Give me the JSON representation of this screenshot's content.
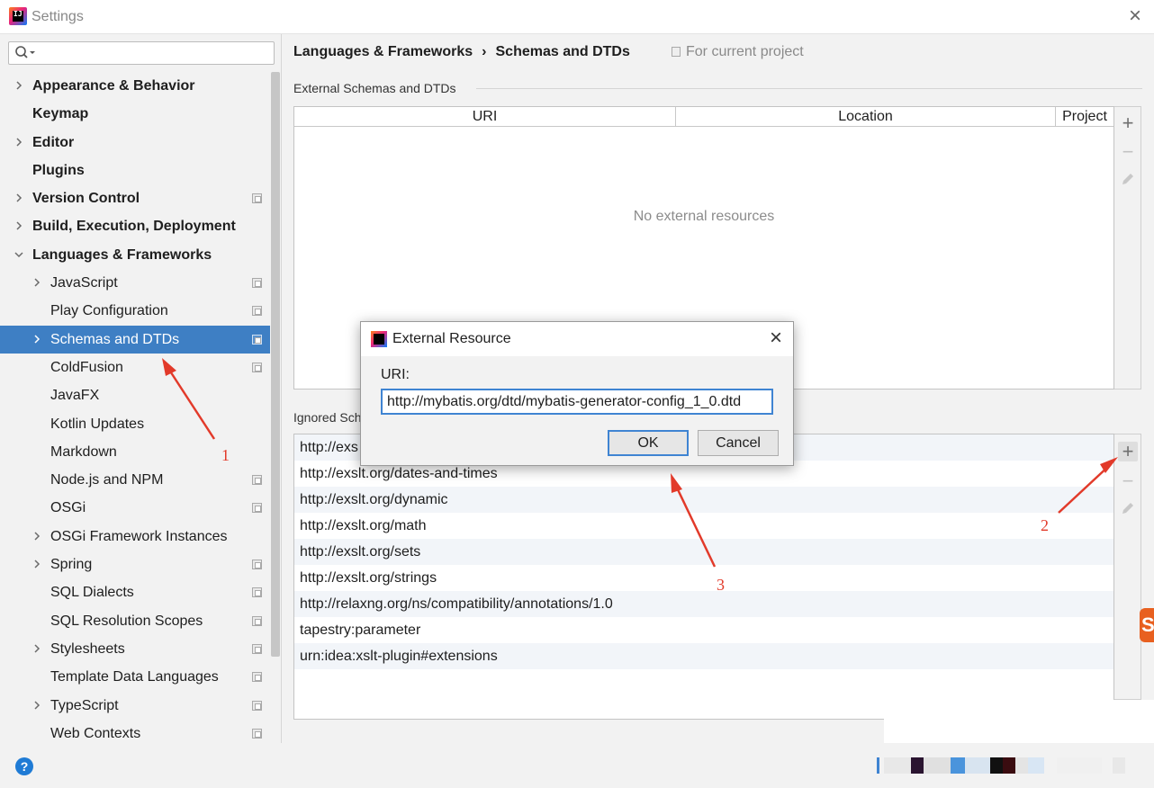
{
  "window": {
    "title": "Settings",
    "close_glyph": "×"
  },
  "search": {
    "placeholder": "",
    "value": ""
  },
  "sidebar": {
    "items": [
      {
        "label": "Appearance & Behavior",
        "level": 0,
        "chevron": "right",
        "project": false,
        "selected": false
      },
      {
        "label": "Keymap",
        "level": 0,
        "chevron": "none",
        "project": false,
        "selected": false
      },
      {
        "label": "Editor",
        "level": 0,
        "chevron": "right",
        "project": false,
        "selected": false
      },
      {
        "label": "Plugins",
        "level": 0,
        "chevron": "none",
        "project": false,
        "selected": false
      },
      {
        "label": "Version Control",
        "level": 0,
        "chevron": "right",
        "project": true,
        "selected": false
      },
      {
        "label": "Build, Execution, Deployment",
        "level": 0,
        "chevron": "right",
        "project": false,
        "selected": false
      },
      {
        "label": "Languages & Frameworks",
        "level": 0,
        "chevron": "down",
        "project": false,
        "selected": false
      },
      {
        "label": "JavaScript",
        "level": 1,
        "chevron": "right",
        "project": true,
        "selected": false
      },
      {
        "label": "Play Configuration",
        "level": 1,
        "chevron": "none",
        "project": true,
        "selected": false
      },
      {
        "label": "Schemas and DTDs",
        "level": 1,
        "chevron": "right",
        "project": true,
        "selected": true
      },
      {
        "label": "ColdFusion",
        "level": 1,
        "chevron": "none",
        "project": true,
        "selected": false
      },
      {
        "label": "JavaFX",
        "level": 1,
        "chevron": "none",
        "project": false,
        "selected": false
      },
      {
        "label": "Kotlin Updates",
        "level": 1,
        "chevron": "none",
        "project": false,
        "selected": false
      },
      {
        "label": "Markdown",
        "level": 1,
        "chevron": "none",
        "project": false,
        "selected": false
      },
      {
        "label": "Node.js and NPM",
        "level": 1,
        "chevron": "none",
        "project": true,
        "selected": false
      },
      {
        "label": "OSGi",
        "level": 1,
        "chevron": "none",
        "project": true,
        "selected": false
      },
      {
        "label": "OSGi Framework Instances",
        "level": 1,
        "chevron": "right",
        "project": false,
        "selected": false
      },
      {
        "label": "Spring",
        "level": 1,
        "chevron": "right",
        "project": true,
        "selected": false
      },
      {
        "label": "SQL Dialects",
        "level": 1,
        "chevron": "none",
        "project": true,
        "selected": false
      },
      {
        "label": "SQL Resolution Scopes",
        "level": 1,
        "chevron": "none",
        "project": true,
        "selected": false
      },
      {
        "label": "Stylesheets",
        "level": 1,
        "chevron": "right",
        "project": true,
        "selected": false
      },
      {
        "label": "Template Data Languages",
        "level": 1,
        "chevron": "none",
        "project": true,
        "selected": false
      },
      {
        "label": "TypeScript",
        "level": 1,
        "chevron": "right",
        "project": true,
        "selected": false
      },
      {
        "label": "Web Contexts",
        "level": 1,
        "chevron": "none",
        "project": true,
        "selected": false
      }
    ]
  },
  "main": {
    "breadcrumb": {
      "parent": "Languages & Frameworks",
      "separator": "›",
      "current": "Schemas and DTDs"
    },
    "scope_label": "For current project",
    "external_section": {
      "title": "External Schemas and DTDs",
      "columns": [
        "URI",
        "Location",
        "Project"
      ],
      "empty_text": "No external resources"
    },
    "ignored_section": {
      "title": "Ignored Sch",
      "rows": [
        "http://exs",
        "http://exslt.org/dates-and-times",
        "http://exslt.org/dynamic",
        "http://exslt.org/math",
        "http://exslt.org/sets",
        "http://exslt.org/strings",
        "http://relaxng.org/ns/compatibility/annotations/1.0",
        "tapestry:parameter",
        "urn:idea:xslt-plugin#extensions"
      ]
    },
    "tools": {
      "add": "+",
      "remove": "−"
    }
  },
  "dialog": {
    "title": "External Resource",
    "close_glyph": "×",
    "uri_label": "URI:",
    "uri_value": "http://mybatis.org/dtd/mybatis-generator-config_1_0.dtd",
    "ok_label": "OK",
    "cancel_label": "Cancel"
  },
  "annotations": {
    "label_1": "1",
    "label_2": "2",
    "label_3": "3",
    "arrow_color": "#e23a2a"
  },
  "statusbar": {
    "help_glyph": "?"
  },
  "colors": {
    "selection": "#3e7fc4",
    "accent": "#3f84d2"
  }
}
